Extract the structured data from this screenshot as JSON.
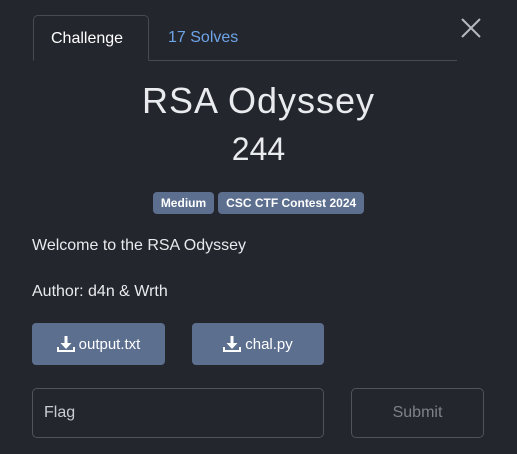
{
  "tabs": {
    "challenge_label": "Challenge",
    "solves_label": "17 Solves"
  },
  "challenge": {
    "name": "RSA Odyssey",
    "points": "244",
    "tags": [
      "Medium",
      "CSC CTF Contest 2024"
    ],
    "description": "Welcome to the RSA Odyssey",
    "author": "Author: d4n & Wrth"
  },
  "files": [
    {
      "name": "output.txt",
      "icon": "download-icon"
    },
    {
      "name": "chal.py",
      "icon": "download-icon"
    }
  ],
  "form": {
    "flag_placeholder": "Flag",
    "submit_label": "Submit"
  },
  "colors": {
    "background": "#23262d",
    "accent_link": "#6ea4e8",
    "tag_bg": "#5c6f8f",
    "border": "#4e535c"
  }
}
